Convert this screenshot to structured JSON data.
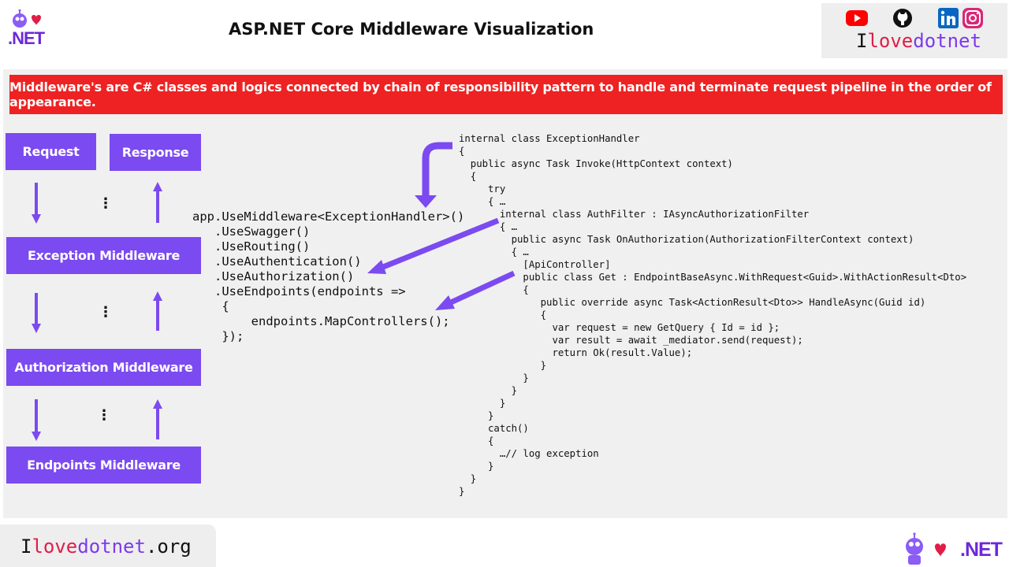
{
  "header": {
    "title": "ASP.NET Core Middleware Visualization",
    "logo_text": ".NET",
    "brand_parts": [
      "I",
      "love",
      "dotnet"
    ],
    "social_icons": [
      "youtube-icon",
      "github-icon",
      "linkedin-icon",
      "instagram-icon"
    ]
  },
  "banner": {
    "text": "Middleware's are C# classes and logics connected by chain of responsibility pattern to handle and terminate request pipeline in the order of appearance."
  },
  "flow": {
    "request_label": "Request",
    "response_label": "Response",
    "middlewares": [
      "Exception Middleware",
      "Authorization Middleware",
      "Endpoints Middleware"
    ],
    "dots": "⋮"
  },
  "pipeline_code": {
    "lines": [
      "app.UseMiddleware<ExceptionHandler>()",
      "   .UseSwagger()",
      "   .UseRouting()",
      "   .UseAuthentication()",
      "   .UseAuthorization()",
      "   .UseEndpoints(endpoints =>",
      "    {",
      "        endpoints.MapControllers();",
      "    });"
    ]
  },
  "handler_code": {
    "lines": [
      "internal class ExceptionHandler",
      "{",
      "  public async Task Invoke(HttpContext context)",
      "  {",
      "     try",
      "     { …",
      "       internal class AuthFilter : IAsyncAuthorizationFilter",
      "       { …",
      "         public async Task OnAuthorization(AuthorizationFilterContext context)",
      "         { …",
      "           [ApiController]",
      "           public class Get : EndpointBaseAsync.WithRequest<Guid>.WithActionResult<Dto>",
      "           {",
      "              public override async Task<ActionResult<Dto>> HandleAsync(Guid id)",
      "              {",
      "                var request = new GetQuery { Id = id };",
      "                var result = await _mediator.send(request);",
      "                return Ok(result.Value);",
      "              }",
      "           }",
      "         }",
      "       }",
      "     }",
      "     catch()",
      "     {",
      "       …// log exception",
      "     }",
      "  }",
      "}"
    ]
  },
  "footer": {
    "brand_parts": [
      "I",
      "love",
      "dotnet",
      ".org"
    ],
    "logo_text": ".NET"
  },
  "colors": {
    "purple": "#7b4af0",
    "banner_red": "#ee2222"
  }
}
